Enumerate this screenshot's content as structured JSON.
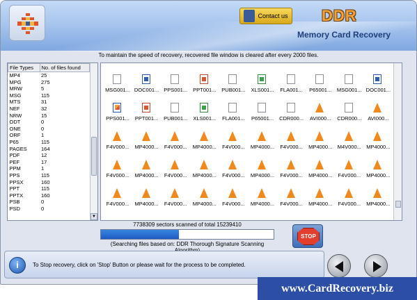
{
  "header": {
    "contact_label": "Contact us",
    "brand": "DDR",
    "product": "Memory Card Recovery"
  },
  "info_line": "To maintain the speed of recovery, recovered file window is cleared after every 2000 files.",
  "file_types": {
    "col1": "File Types",
    "col2": "No. of files found",
    "rows": [
      [
        "MP4",
        "25"
      ],
      [
        "MPG",
        "275"
      ],
      [
        "MRW",
        "5"
      ],
      [
        "MSG",
        "115"
      ],
      [
        "MTS",
        "31"
      ],
      [
        "NEF",
        "32"
      ],
      [
        "NRW",
        "15"
      ],
      [
        "ODT",
        "0"
      ],
      [
        "ONE",
        "0"
      ],
      [
        "ORF",
        "1"
      ],
      [
        "P65",
        "115"
      ],
      [
        "PAGES",
        "164"
      ],
      [
        "PDF",
        "12"
      ],
      [
        "PEF",
        "17"
      ],
      [
        "PPM",
        "1"
      ],
      [
        "PPS",
        "115"
      ],
      [
        "PPSX",
        "160"
      ],
      [
        "PPT",
        "115"
      ],
      [
        "PPTX",
        "160"
      ],
      [
        "PSB",
        "0"
      ],
      [
        "PSD",
        "0"
      ]
    ]
  },
  "files": [
    {
      "name": "MSG001...",
      "icon": "doc-icon"
    },
    {
      "name": "DOC001...",
      "icon": "word-icon"
    },
    {
      "name": "PPS001...",
      "icon": "doc-icon"
    },
    {
      "name": "PPT001...",
      "icon": "ppt-icon"
    },
    {
      "name": "PUB001...",
      "icon": "doc-icon"
    },
    {
      "name": "XLS001...",
      "icon": "xls-icon"
    },
    {
      "name": "FLA001...",
      "icon": "doc-icon"
    },
    {
      "name": "P65001...",
      "icon": "doc-icon"
    },
    {
      "name": "MSG001...",
      "icon": "doc-icon"
    },
    {
      "name": "DOC001...",
      "icon": "word-icon"
    },
    {
      "name": "PPS001...",
      "icon": "pps-icon"
    },
    {
      "name": "PPT001...",
      "icon": "ppt-icon"
    },
    {
      "name": "PUB001...",
      "icon": "doc-icon"
    },
    {
      "name": "XLS001...",
      "icon": "xls-icon"
    },
    {
      "name": "FLA001...",
      "icon": "doc-icon"
    },
    {
      "name": "P65001...",
      "icon": "doc-icon"
    },
    {
      "name": "CDR000...",
      "icon": "doc-icon"
    },
    {
      "name": "AVI000...",
      "icon": "vlc-icon"
    },
    {
      "name": "CDR000...",
      "icon": "doc-icon"
    },
    {
      "name": "AVI000...",
      "icon": "vlc-icon"
    },
    {
      "name": "F4V000...",
      "icon": "vlc-icon"
    },
    {
      "name": "MP4000...",
      "icon": "vlc-icon"
    },
    {
      "name": "F4V000...",
      "icon": "vlc-icon"
    },
    {
      "name": "MP4000...",
      "icon": "vlc-icon"
    },
    {
      "name": "F4V000...",
      "icon": "vlc-icon"
    },
    {
      "name": "MP4000...",
      "icon": "vlc-icon"
    },
    {
      "name": "F4V000...",
      "icon": "vlc-icon"
    },
    {
      "name": "MP4000...",
      "icon": "vlc-icon"
    },
    {
      "name": "M4V000...",
      "icon": "vlc-icon"
    },
    {
      "name": "MP4000...",
      "icon": "vlc-icon"
    },
    {
      "name": "F4V000...",
      "icon": "vlc-icon"
    },
    {
      "name": "MP4000...",
      "icon": "vlc-icon"
    },
    {
      "name": "F4V000...",
      "icon": "vlc-icon"
    },
    {
      "name": "MP4000...",
      "icon": "vlc-icon"
    },
    {
      "name": "F4V000...",
      "icon": "vlc-icon"
    },
    {
      "name": "MP4000...",
      "icon": "vlc-icon"
    },
    {
      "name": "F4V000...",
      "icon": "vlc-icon"
    },
    {
      "name": "MP4000...",
      "icon": "vlc-icon"
    },
    {
      "name": "F4V000...",
      "icon": "vlc-icon"
    },
    {
      "name": "MP4000...",
      "icon": "vlc-icon"
    },
    {
      "name": "F4V000...",
      "icon": "vlc-icon"
    },
    {
      "name": "MP4000...",
      "icon": "vlc-icon"
    },
    {
      "name": "F4V000...",
      "icon": "vlc-icon"
    },
    {
      "name": "MP4000...",
      "icon": "vlc-icon"
    },
    {
      "name": "F4V000...",
      "icon": "vlc-icon"
    },
    {
      "name": "MP4000...",
      "icon": "vlc-icon"
    },
    {
      "name": "F4V000...",
      "icon": "vlc-icon"
    },
    {
      "name": "MP4000...",
      "icon": "vlc-icon"
    },
    {
      "name": "F4V000...",
      "icon": "vlc-icon"
    },
    {
      "name": "MP4000...",
      "icon": "vlc-icon"
    }
  ],
  "scan": {
    "status": "7738309 sectors scanned of total 15239410",
    "progress": 0.45,
    "algorithm": "(Searching files based on:  DDR Thorough Signature Scanning Algorithm)"
  },
  "stop_label": "STOP",
  "bottom": {
    "info_glyph": "i",
    "message": "To Stop recovery, click on 'Stop' Button or please wait for the process to be completed."
  },
  "website": "www.CardRecovery.biz",
  "colors": {
    "accent": "#2d4ea5",
    "brand": "#f2a23a",
    "progress": "#1d5bc4",
    "stop": "#e33d2e"
  }
}
